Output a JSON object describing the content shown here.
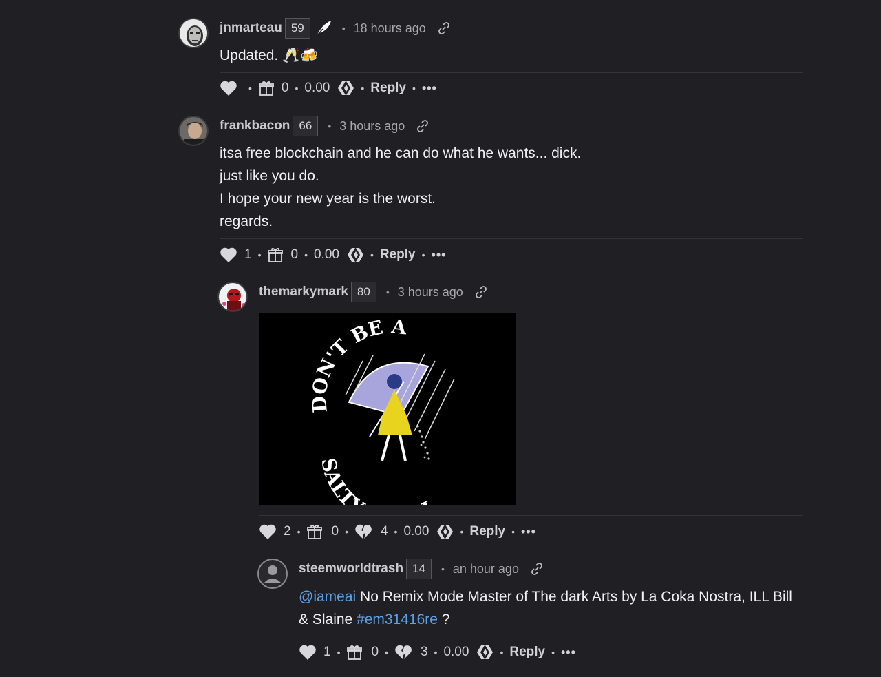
{
  "comments": [
    {
      "author": "jnmarteau",
      "reputation": "59",
      "time": "18 hours ago",
      "body": [
        "Updated. 🥂🍻"
      ],
      "votes": "",
      "gifts": "0",
      "payout": "0.00",
      "reply": "Reply"
    },
    {
      "author": "frankbacon",
      "reputation": "66",
      "time": "3 hours ago",
      "body": [
        "itsa free blockchain and he can do what he wants... dick.",
        "just like you do.",
        "I hope your new year is the worst.",
        "regards."
      ],
      "votes": "1",
      "gifts": "0",
      "payout": "0.00",
      "reply": "Reply"
    },
    {
      "author": "themarkymark",
      "reputation": "80",
      "time": "3 hours ago",
      "image_text": {
        "top": "DON'T BE A",
        "bottom": "SALTY BITCH"
      },
      "votes": "2",
      "gifts": "0",
      "downvotes": "4",
      "payout": "0.00",
      "reply": "Reply"
    },
    {
      "author": "steemworldtrash",
      "reputation": "14",
      "time": "an hour ago",
      "mention": "@iameai",
      "text1": " No Remix Mode Master of The dark Arts by La Coka Nostra, ILL Bill",
      "text2": "& Slaine ",
      "hashtag": "#em31416re",
      "text3": " ?",
      "votes": "1",
      "gifts": "0",
      "downvotes": "3",
      "payout": "0.00",
      "reply": "Reply"
    }
  ],
  "icons": {
    "heart": "heart-icon",
    "gift": "gift-icon",
    "broken_heart": "broken-heart-icon",
    "hive": "hive-icon",
    "link": "link-icon",
    "more": "more-icon",
    "quill": "quill-icon"
  },
  "colors": {
    "background": "#202024",
    "link": "#5ea0e8",
    "muted": "#a7a7ad"
  }
}
